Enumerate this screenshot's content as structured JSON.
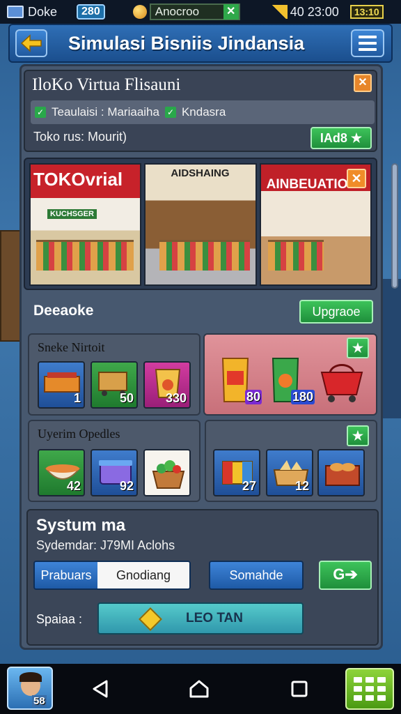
{
  "status_bar": {
    "app_label": "Doke",
    "pill": "280",
    "search_text": "Anocroo",
    "close_glyph": "✕",
    "time": "40 23:00",
    "battery": "13:10"
  },
  "header": {
    "title": "Simulasi Bisniis Jindansia"
  },
  "store": {
    "name": "IloKo Virtua Flisauni",
    "tag1": "Teaulaisi : Mariaaiha",
    "tag2": "Kndasra",
    "status": "Toko rus: Mourit)",
    "add_label": "IAd8 ★",
    "close_glyph": "✕"
  },
  "gallery": {
    "shop1_sign": "TOKOvrial",
    "shop1_sub": "KUCHSGER",
    "shop2_sign": "AIDSHAING",
    "shop3_sign": "AINBEUATIOH",
    "close_glyph": "✕"
  },
  "decade": {
    "label": "Deeaoke",
    "upgrade_label": "Upgraoe"
  },
  "stock_panel": {
    "title": "Sneke Nirtoit",
    "items": [
      {
        "value": "1"
      },
      {
        "value": "50"
      },
      {
        "value": "330"
      }
    ]
  },
  "promo_panel": {
    "items": [
      {
        "value": "80"
      },
      {
        "value": "180"
      }
    ],
    "plus_glyph": "★"
  },
  "dish_panel": {
    "title": "Uyerim Opedles",
    "items": [
      {
        "value": "42"
      },
      {
        "value": "92"
      }
    ]
  },
  "box_panel": {
    "items": [
      {
        "value": "27"
      },
      {
        "value": "12"
      }
    ],
    "plus_glyph": "★"
  },
  "system": {
    "title": "Systum ma",
    "subtitle": "Sydemdar: J79MI Aclohs",
    "seg_a": "Prabuars",
    "seg_b": "Gnodiang",
    "somande_label": "Somahde",
    "go_label": "G➔",
    "spaiaa_label": "Spaiaa :",
    "progress_text": "LEO TAN",
    "progress_fraction": 1.0
  },
  "nav": {
    "avatar_num": "58"
  }
}
